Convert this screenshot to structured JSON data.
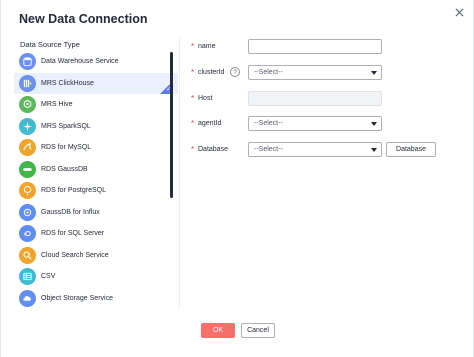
{
  "dialog": {
    "title": "New Data Connection",
    "close_icon": "close-icon"
  },
  "source": {
    "label": "Data Source Type",
    "items": [
      {
        "label": "Data Warehouse Service",
        "icon": "database-icon",
        "color": "#6c8ff2",
        "selected": false
      },
      {
        "label": "MRS ClickHouse",
        "icon": "clickhouse-icon",
        "color": "#6c8ff2",
        "selected": true
      },
      {
        "label": "MRS Hive",
        "icon": "hive-icon",
        "color": "#5cb85c",
        "selected": false
      },
      {
        "label": "MRS SparkSQL",
        "icon": "spark-icon",
        "color": "#3fbad0",
        "selected": false
      },
      {
        "label": "RDS for MySQL",
        "icon": "mysql-icon",
        "color": "#f0a42b",
        "selected": false
      },
      {
        "label": "RDS GaussDB",
        "icon": "gaussdb-icon",
        "color": "#43b649",
        "selected": false
      },
      {
        "label": "RDS for PostgreSQL",
        "icon": "postgresql-icon",
        "color": "#f0a42b",
        "selected": false
      },
      {
        "label": "GaussDB for Influx",
        "icon": "influx-icon",
        "color": "#5f8ef0",
        "selected": false
      },
      {
        "label": "RDS for SQL Server",
        "icon": "sqlserver-icon",
        "color": "#5f8ef0",
        "selected": false
      },
      {
        "label": "Cloud Search Service",
        "icon": "search-service-icon",
        "color": "#f0a42b",
        "selected": false
      },
      {
        "label": "CSV",
        "icon": "csv-icon",
        "color": "#3fbad0",
        "selected": false
      },
      {
        "label": "Object Storage Service",
        "icon": "storage-icon",
        "color": "#5f8ef0",
        "selected": false
      }
    ]
  },
  "form": {
    "name": {
      "label": "name",
      "value": ""
    },
    "clusterid": {
      "label": "clusterId",
      "placeholder": "--Select--",
      "help": "?"
    },
    "host": {
      "label": "Host",
      "value": ""
    },
    "agentid": {
      "label": "agentId",
      "placeholder": "--Select--"
    },
    "database": {
      "label": "Database",
      "placeholder": "--Select--",
      "button": "Database"
    },
    "required_mark": "*"
  },
  "footer": {
    "ok_label": "OK",
    "cancel_label": "Cancel"
  },
  "colors": {
    "primary": "#5e7ce0",
    "ok": "#f66f6a",
    "required": "#e54545"
  }
}
